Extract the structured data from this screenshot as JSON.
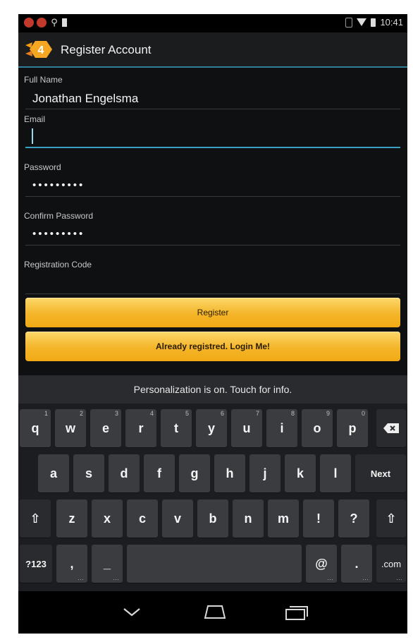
{
  "status_bar": {
    "time": "10:41"
  },
  "action_bar": {
    "title": "Register Account",
    "app_icon": "app-logo-icon"
  },
  "form": {
    "full_name": {
      "label": "Full Name",
      "value": "Jonathan Engelsma"
    },
    "email": {
      "label": "Email",
      "value": ""
    },
    "password": {
      "label": "Password",
      "value": "•••••••••"
    },
    "confirm_password": {
      "label": "Confirm Password",
      "value": "•••••••••"
    },
    "registration_code": {
      "label": "Registration Code",
      "value": ""
    }
  },
  "buttons": {
    "register": "Register",
    "login": "Already registred. Login Me!"
  },
  "keyboard": {
    "hint": "Personalization is on. Touch for info.",
    "row1": [
      {
        "k": "q",
        "s": "1"
      },
      {
        "k": "w",
        "s": "2"
      },
      {
        "k": "e",
        "s": "3"
      },
      {
        "k": "r",
        "s": "4"
      },
      {
        "k": "t",
        "s": "5"
      },
      {
        "k": "y",
        "s": "6"
      },
      {
        "k": "u",
        "s": "7"
      },
      {
        "k": "i",
        "s": "8"
      },
      {
        "k": "o",
        "s": "9"
      },
      {
        "k": "p",
        "s": "0"
      }
    ],
    "row2": [
      "a",
      "s",
      "d",
      "f",
      "g",
      "h",
      "j",
      "k",
      "l"
    ],
    "next": "Next",
    "row3": [
      "z",
      "x",
      "c",
      "v",
      "b",
      "n",
      "m",
      "!",
      "?"
    ],
    "sym": "?123",
    "comma": ",",
    "dash": "_",
    "at": "@",
    "period": ".",
    "dotcom": ".com",
    "backspace": "⌫",
    "shift": "⇧"
  }
}
